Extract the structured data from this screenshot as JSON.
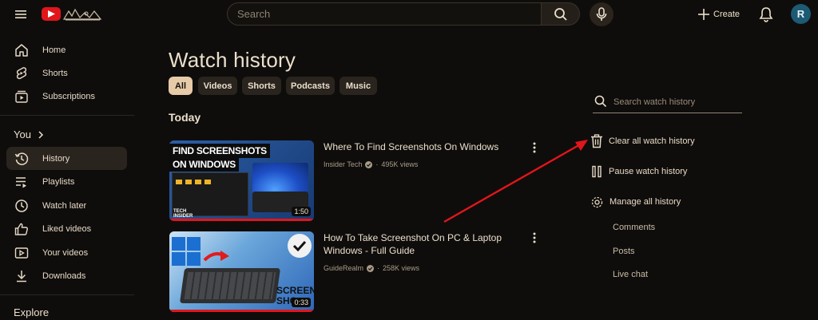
{
  "header": {
    "search_placeholder": "Search",
    "create_label": "Create",
    "avatar_initial": "R"
  },
  "sidebar": {
    "primary": [
      {
        "label": "Home",
        "icon": "home-icon"
      },
      {
        "label": "Shorts",
        "icon": "shorts-icon"
      },
      {
        "label": "Subscriptions",
        "icon": "subscriptions-icon"
      }
    ],
    "you_title": "You",
    "you_items": [
      {
        "label": "History",
        "icon": "history-icon",
        "active": true
      },
      {
        "label": "Playlists",
        "icon": "playlists-icon"
      },
      {
        "label": "Watch later",
        "icon": "watch-later-icon"
      },
      {
        "label": "Liked videos",
        "icon": "thumb-up-icon"
      },
      {
        "label": "Your videos",
        "icon": "your-videos-icon"
      },
      {
        "label": "Downloads",
        "icon": "download-icon"
      }
    ],
    "explore_title": "Explore"
  },
  "main": {
    "title": "Watch history",
    "chips": [
      "All",
      "Videos",
      "Shorts",
      "Podcasts",
      "Music"
    ],
    "active_chip": "All",
    "section": "Today",
    "videos": [
      {
        "title": "Where To Find Screenshots On Windows",
        "channel": "Insider Tech",
        "views": "495K views",
        "duration": "1:50",
        "thumb_text_1": "FIND SCREENSHOTS",
        "thumb_text_2": "ON WINDOWS",
        "thumb_brand_1": "TECH",
        "thumb_brand_2": "INSIDER"
      },
      {
        "title_line1": "How To Take Screenshot On PC & Laptop",
        "title_line2": "Windows - Full Guide",
        "channel": "GuideRealm",
        "views": "258K views",
        "duration": "0:33",
        "thumb_text_1": "SCREEN",
        "thumb_text_2": "SHO"
      }
    ]
  },
  "right_panel": {
    "search_placeholder": "Search watch history",
    "actions": [
      {
        "label": "Clear all watch history",
        "icon": "trash-icon"
      },
      {
        "label": "Pause watch history",
        "icon": "pause-icon"
      },
      {
        "label": "Manage all history",
        "icon": "gear-icon"
      }
    ],
    "sub_items": [
      "Comments",
      "Posts",
      "Live chat"
    ]
  },
  "colors": {
    "background": "#0f0d0b",
    "text": "#eadfcc",
    "active_chip": "#e7caa8",
    "youtube_red": "#e0161b",
    "annotation_arrow": "#e0161b",
    "avatar": "#1d5a74"
  }
}
